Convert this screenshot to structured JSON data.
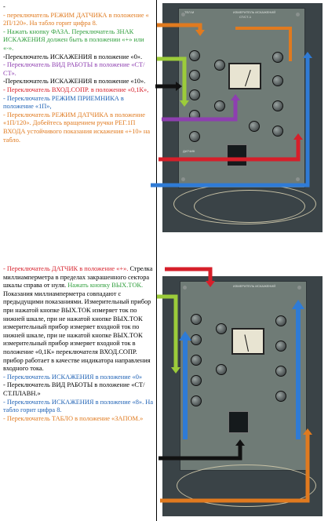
{
  "block1": [
    {
      "text": "-",
      "color": "black"
    },
    {
      "text": "- переключатель  РЕЖИМ ДАТЧИКА в положение « 2П/120». На табло горит цифра 8.",
      "color": "orange"
    },
    {
      "text": "- Нажать кнопку ФАЗА. Переключатель ЗНАК ИСКАЖЕНИЯ должен быть в положении «+» или «-».",
      "color": "green"
    },
    {
      "text": "-Переключатель ИСКАЖЕНИЯ в положение «0».",
      "color": "black"
    },
    {
      "text": "- Переключатель  ВИД РАБОТЫ в положение «СТ/СТ».",
      "color": "purple"
    },
    {
      "text": "-Переключатель ИСКАЖЕНИЯ в положение «10».",
      "color": "black"
    },
    {
      "text": "- Переключатель ВХОД.СОПР. в положение «0,1К»,",
      "color": "red"
    },
    {
      "text": "- Переключатель РЕЖИМ ПРИЕМНИКА в положение «1П»,",
      "color": "blue"
    },
    {
      "text": "- Переключатель РЕЖИМ ДАТЧИКА в положение «1П/120». Добейтесь вращением ручки РЕГ.1П ВХОДА устойчивого показания искажения «+10» на табло.",
      "color": "orange"
    }
  ],
  "block2": [
    {
      "runs": [
        {
          "text": "- Переключатель ДАТЧИК в положение «+».",
          "color": "red"
        },
        {
          "text": " Стрелка миллиамперметра в пределах закрашенного сектора шкалы справа от нуля. ",
          "color": "black"
        },
        {
          "text": "Нажать кнопку ВЫХ.ТОК.",
          "color": "green"
        },
        {
          "text": " Показания миллиамперметра совпадают с предыдущими показаниями. Измерительный прибор при нажатой кнопке ВЫХ.ТОК измеряет ток по нижней шкале, при не нажатой кнопке ВЫХ.ТОК измерительный прибор измеряет входной ток по нижней шкале, при не нажатой кнопке ВЫХ.ТОК измерительный прибор измеряет входной ток в положение «0,1К» переключателя ВХОД.СОПР. прибор работает в качестве индикатора направления входного тока.",
          "color": "black"
        }
      ]
    },
    {
      "runs": [
        {
          "text": "- Переключатель ИСКАЖЕНИЯ в положение «0»",
          "color": "blue"
        }
      ]
    },
    {
      "runs": [
        {
          "text": "- Переключатель ВИД РАБОТЫ в положение «СТ/СТ.ПЛАВН.»",
          "color": "black"
        }
      ]
    },
    {
      "runs": [
        {
          "text": "- Переключатель ИСКАЖЕНИЯ в положение «8». На табло горит цифра 8.",
          "color": "blue"
        }
      ]
    },
    {
      "runs": [
        {
          "text": "- Переключатель ТАБЛО в положение «ЗАПОМ.»",
          "color": "orange"
        }
      ]
    }
  ],
  "colors": {
    "orange": "#e07a1f",
    "green": "#2f9e3c",
    "purple": "#8e3fb0",
    "red": "#d61f2a",
    "blue": "#1f62b5",
    "black": "#111111"
  },
  "panel_labels": {
    "top1": "ИЗМЕРИТЕЛЬ ИСКАЖЕНИЙ",
    "top2": "СТ/СТ-1",
    "top3": "ТЕЛ.М",
    "datchik": "ДАТЧИК"
  }
}
